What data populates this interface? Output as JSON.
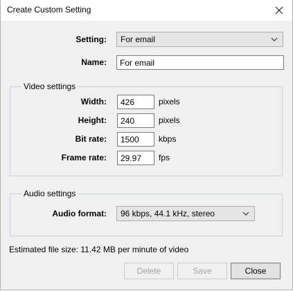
{
  "window": {
    "title": "Create Custom Setting",
    "close_icon": "close-icon"
  },
  "setting": {
    "label": "Setting:",
    "value": "For email"
  },
  "name": {
    "label": "Name:",
    "value": "For email"
  },
  "video": {
    "group_title": "Video settings",
    "width": {
      "label": "Width:",
      "value": "426",
      "unit": "pixels"
    },
    "height": {
      "label": "Height:",
      "value": "240",
      "unit": "pixels"
    },
    "bitrate": {
      "label": "Bit rate:",
      "value": "1500",
      "unit": "kbps"
    },
    "framerate": {
      "label": "Frame rate:",
      "value": "29.97",
      "unit": "fps"
    }
  },
  "audio": {
    "group_title": "Audio settings",
    "format": {
      "label": "Audio format:",
      "value": "96 kbps, 44.1 kHz, stereo"
    }
  },
  "status": {
    "estimate": "Estimated file size: 11.42 MB per minute of video"
  },
  "buttons": {
    "delete": "Delete",
    "save": "Save",
    "close": "Close"
  }
}
